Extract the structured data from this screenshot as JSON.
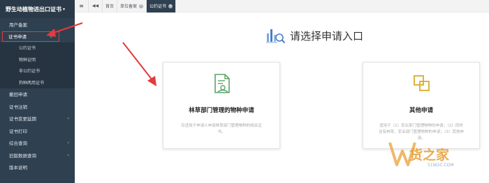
{
  "sidebar": {
    "brand": "野生动植物进出口证书",
    "items": [
      {
        "label": "用户备案"
      },
      {
        "label": "证书申请"
      },
      {
        "label": "撤回申请"
      },
      {
        "label": "证书注销"
      },
      {
        "label": "证书变更延期"
      },
      {
        "label": "证书打印"
      },
      {
        "label": "综合查询"
      },
      {
        "label": "旧版数据查询"
      },
      {
        "label": "版本说明"
      }
    ],
    "subitems": [
      {
        "label": "公约证书"
      },
      {
        "label": "物种证明"
      },
      {
        "label": "非公约证书"
      },
      {
        "label": "狗种两用证书"
      }
    ]
  },
  "topbar": {
    "menu_icon": "≡",
    "back_icon": "◀◀",
    "tabs": [
      {
        "label": "首页"
      },
      {
        "label": "单位备案"
      },
      {
        "label": "公约证书"
      }
    ]
  },
  "main": {
    "title": "请选择申请入口",
    "cards": [
      {
        "title": "林草部门管理的物种申请",
        "desc": "仅适用于申请人申请林草部门管理物种的相关证书。"
      },
      {
        "title": "其他申请",
        "desc": "适用于（1）农业部门管理物种的申请；（2）同时含有林草、农业部门管理物种的申请；（3）其他申请。"
      }
    ]
  },
  "watermark": {
    "text": "货之家",
    "url": "51W2C.COM"
  },
  "colors": {
    "sidebar_bg": "#2f4050",
    "highlight_red": "#e23b3b",
    "icon_green": "#5aa36a",
    "icon_gold": "#d9ad2c"
  }
}
